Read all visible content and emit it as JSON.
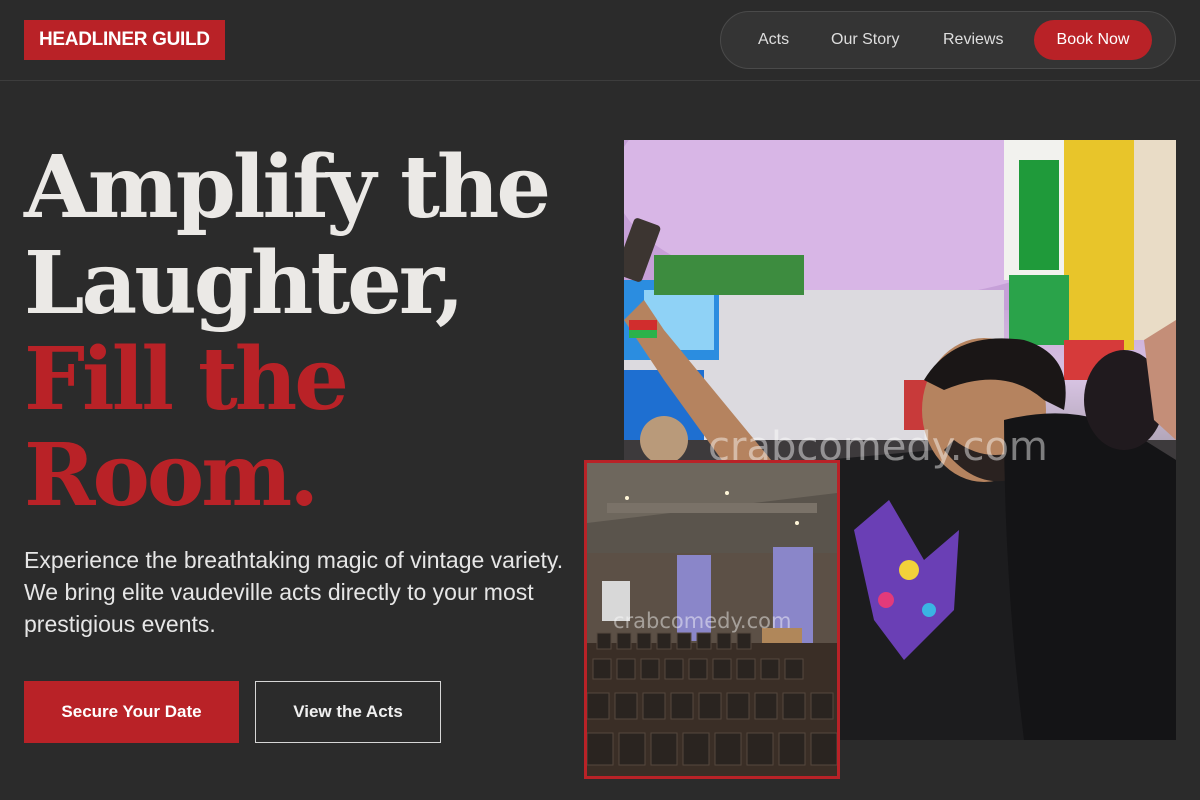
{
  "header": {
    "logo": "HEADLINER GUILD",
    "nav": {
      "links": [
        "Acts",
        "Our Story",
        "Reviews"
      ],
      "cta": "Book Now"
    }
  },
  "hero": {
    "headline_line1": "Amplify the",
    "headline_line2": "Laughter,",
    "headline_line3": "Fill the",
    "headline_line4": "Room.",
    "subtext": "Experience the breathtaking magic of vintage variety. We bring elite vaudeville acts directly to your most prestigious events.",
    "primary_button": "Secure Your Date",
    "secondary_button": "View the Acts"
  },
  "images": {
    "main_watermark": "crabcomedy.com",
    "small_watermark": "crabcomedy.com"
  },
  "colors": {
    "background": "#2b2b2b",
    "accent_red": "#b92227",
    "text_light": "#ebe9e6"
  }
}
